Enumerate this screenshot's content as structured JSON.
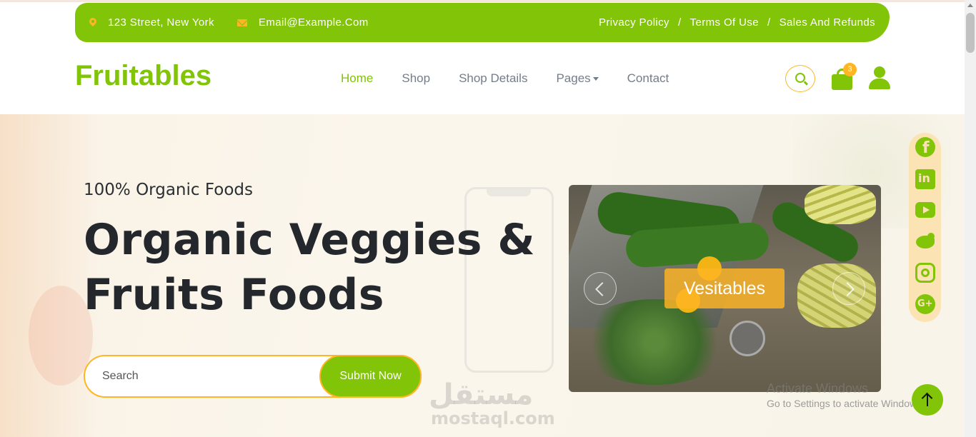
{
  "topbar": {
    "address": "123 Street, New York",
    "email": "Email@Example.Com",
    "links": [
      "Privacy Policy",
      "Terms Of Use",
      "Sales And Refunds"
    ],
    "separator": "/"
  },
  "brand": {
    "name": "Fruitables",
    "color": "#81c408",
    "accent": "#ffb524"
  },
  "nav": {
    "items": [
      "Home",
      "Shop",
      "Shop Details",
      "Pages",
      "Contact"
    ],
    "active": "Home"
  },
  "cart": {
    "count": "3"
  },
  "hero": {
    "subtitle": "100% Organic Foods",
    "headline_line1": "Organic Veggies &",
    "headline_line2": "Fruits Foods",
    "search_placeholder": "Search",
    "submit_label": "Submit Now",
    "carousel_caption": "Vesitables"
  },
  "social_icons": [
    "facebook-icon",
    "linkedin-icon",
    "youtube-icon",
    "twitter-icon",
    "instagram-icon",
    "google-plus-icon"
  ],
  "watermark": {
    "arabic": "مستقل",
    "latin": "mostaql.com"
  },
  "os_notice": {
    "line1": "Activate Windows",
    "line2": "Go to Settings to activate Windows."
  }
}
